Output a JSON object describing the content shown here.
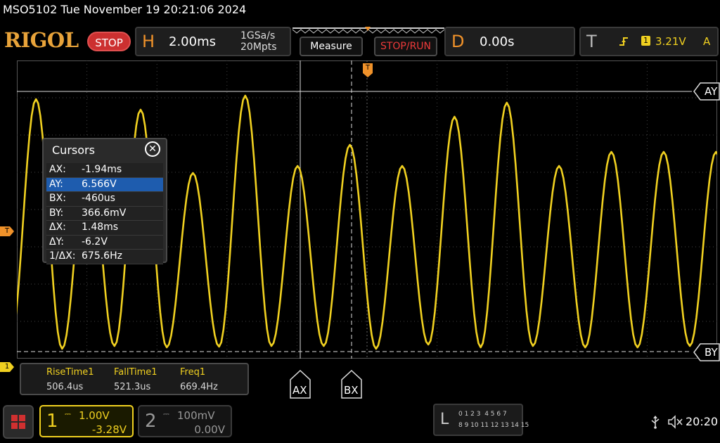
{
  "header": {
    "model_datetime": "MSO5102  Tue November 19 20:21:06 2024",
    "brand": "RIGOL",
    "stop_label": "STOP",
    "horizontal": {
      "letter": "H",
      "timebase": "2.00ms",
      "sample_rate": "1GSa/s",
      "memory_depth": "20Mpts"
    },
    "measure_label": "Measure",
    "stoprun_label": "STOP/RUN",
    "delay": {
      "letter": "D",
      "value": "0.00s"
    },
    "trigger": {
      "letter": "T",
      "channel": "1",
      "level": "3.21V",
      "mode": "A"
    }
  },
  "cursors": {
    "title": "Cursors",
    "rows": [
      {
        "label": "AX:",
        "value": "-1.94ms"
      },
      {
        "label": "AY:",
        "value": "6.566V"
      },
      {
        "label": "BX:",
        "value": "-460us"
      },
      {
        "label": "BY:",
        "value": "366.6mV"
      },
      {
        "label": "ΔX:",
        "value": "1.48ms"
      },
      {
        "label": "ΔY:",
        "value": "-6.2V"
      },
      {
        "label": "1/ΔX:",
        "value": "675.6Hz"
      }
    ],
    "selected_row": 1,
    "ay_tag": "AY",
    "by_tag": "BY",
    "ax_tag": "AX",
    "bx_tag": "BX"
  },
  "measurements": [
    {
      "name": "RiseTime1",
      "value": "506.4us"
    },
    {
      "name": "FallTime1",
      "value": "521.3us"
    },
    {
      "name": "Freq1",
      "value": "669.4Hz"
    }
  ],
  "channels": {
    "ch1": {
      "number": "1",
      "scale": "1.00V",
      "offset": "-3.28V"
    },
    "ch2": {
      "number": "2",
      "scale": "100mV",
      "offset": "0.00V"
    }
  },
  "markers": {
    "trigger_level": "T",
    "ch1_ground": "1",
    "trigger_position": "T"
  },
  "la": {
    "letter": "L",
    "row1": "0 1 2 3  4 5 6 7",
    "row2": "8 9 10 11 12 13 14 15"
  },
  "status": {
    "time": "20:20"
  },
  "icons": {
    "usb": "usb-icon",
    "mute": "speaker-mute-icon",
    "menu": "menu-grid-icon"
  },
  "colors": {
    "ch1": "#f0d020",
    "accent": "#f0922a",
    "stop": "#cc3030",
    "selected": "#1e5cae"
  },
  "chart_data": {
    "type": "line",
    "series": [
      {
        "name": "1",
        "waveform": "sine",
        "frequency_hz": 669.4
      }
    ],
    "timebase_per_div": "2.00ms",
    "volts_per_div": "1.00V",
    "grid": true
  }
}
